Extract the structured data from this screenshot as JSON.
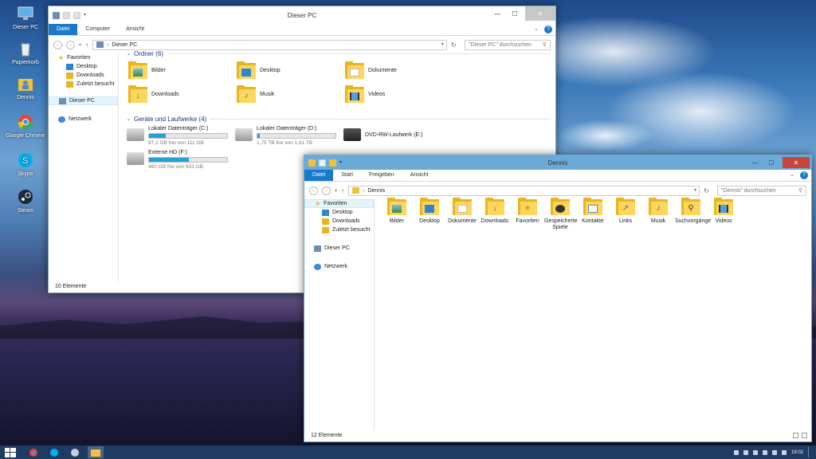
{
  "desktop": {
    "icons": [
      {
        "label": "Dieser PC",
        "icon": "computer-icon"
      },
      {
        "label": "Papierkorb",
        "icon": "recycle-bin-icon"
      },
      {
        "label": "Dennis",
        "icon": "user-folder-icon"
      },
      {
        "label": "Google Chrome",
        "icon": "chrome-icon"
      },
      {
        "label": "Skype",
        "icon": "skype-icon"
      },
      {
        "label": "Steam",
        "icon": "steam-icon"
      }
    ]
  },
  "win1": {
    "title": "Dieser PC",
    "tabs": [
      "Datei",
      "Computer",
      "Ansicht"
    ],
    "breadcrumb": "Dieser PC",
    "search_placeholder": "\"Dieser PC\" durchsuchen",
    "nav": {
      "favorites": "Favoriten",
      "fav_items": [
        "Desktop",
        "Downloads",
        "Zuletzt besucht"
      ],
      "this_pc": "Dieser PC",
      "network": "Netzwerk"
    },
    "folders_header": "Ordner (6)",
    "folders": [
      "Bilder",
      "Desktop",
      "Dokumente",
      "Downloads",
      "Musik",
      "Videos"
    ],
    "drives_header": "Geräte und Laufwerke (4)",
    "drives": [
      {
        "name": "Lokaler Datenträger (C:)",
        "free": "87,2 GB frei von 111 GB",
        "used_fraction": 0.21
      },
      {
        "name": "Lokaler Datenträger (D:)",
        "free": "1,75 TB frei von 1,81 TB",
        "used_fraction": 0.03
      },
      {
        "name": "DVD-RW-Laufwerk (E:)",
        "free": ""
      },
      {
        "name": "Externe HD (F:)",
        "free": "460 GB frei von 931 GB",
        "used_fraction": 0.51
      }
    ],
    "status": "10 Elemente"
  },
  "win2": {
    "title": "Dennis",
    "tabs": [
      "Datei",
      "Start",
      "Freigeben",
      "Ansicht"
    ],
    "breadcrumb": "Dennis",
    "search_placeholder": "\"Dennis\" durchsuchen",
    "nav": {
      "favorites": "Favoriten",
      "fav_items": [
        "Desktop",
        "Downloads",
        "Zuletzt besucht"
      ],
      "this_pc": "Dieser PC",
      "network": "Netzwerk"
    },
    "folders": [
      "Bilder",
      "Desktop",
      "Dokumente",
      "Downloads",
      "Favoriten",
      "Gespeicherte Spiele",
      "Kontakte",
      "Links",
      "Musik",
      "Suchvorgänge",
      "Videos"
    ],
    "status": "12 Elemente"
  },
  "taskbar": {
    "clock": "19:02"
  },
  "colors": {
    "accent": "#1979ca",
    "folder": "#ffd65c",
    "win2_border": "#6aa9d8"
  }
}
